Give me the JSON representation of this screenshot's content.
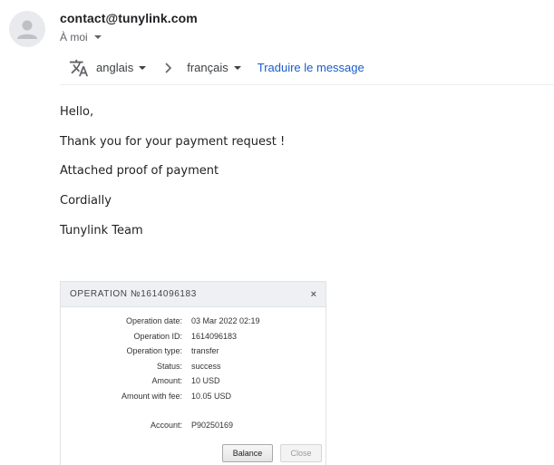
{
  "email": {
    "sender": "contact@tunylink.com",
    "recipient": "À moi"
  },
  "translate": {
    "from_lang": "anglais",
    "to_lang": "français",
    "action": "Traduire le message"
  },
  "message": {
    "greeting": "Hello,",
    "line1": "Thank you for your payment request !",
    "line2": "Attached proof of payment",
    "line3": "Cordially",
    "signature": "Tunylink Team"
  },
  "receipt": {
    "title": "OPERATION №1614096183",
    "close_icon": "×",
    "rows": [
      {
        "label": "Operation date:",
        "value": "03 Mar 2022 02:19"
      },
      {
        "label": "Operation ID:",
        "value": "1614096183"
      },
      {
        "label": "Operation type:",
        "value": "transfer"
      },
      {
        "label": "Status:",
        "value": "success"
      },
      {
        "label": "Amount:",
        "value": "10 USD"
      },
      {
        "label": "Amount with fee:",
        "value": "10.05 USD"
      },
      {
        "label": "Account:",
        "value": "P90250169"
      }
    ],
    "balance_button": "Balance",
    "close_button": "Close"
  }
}
